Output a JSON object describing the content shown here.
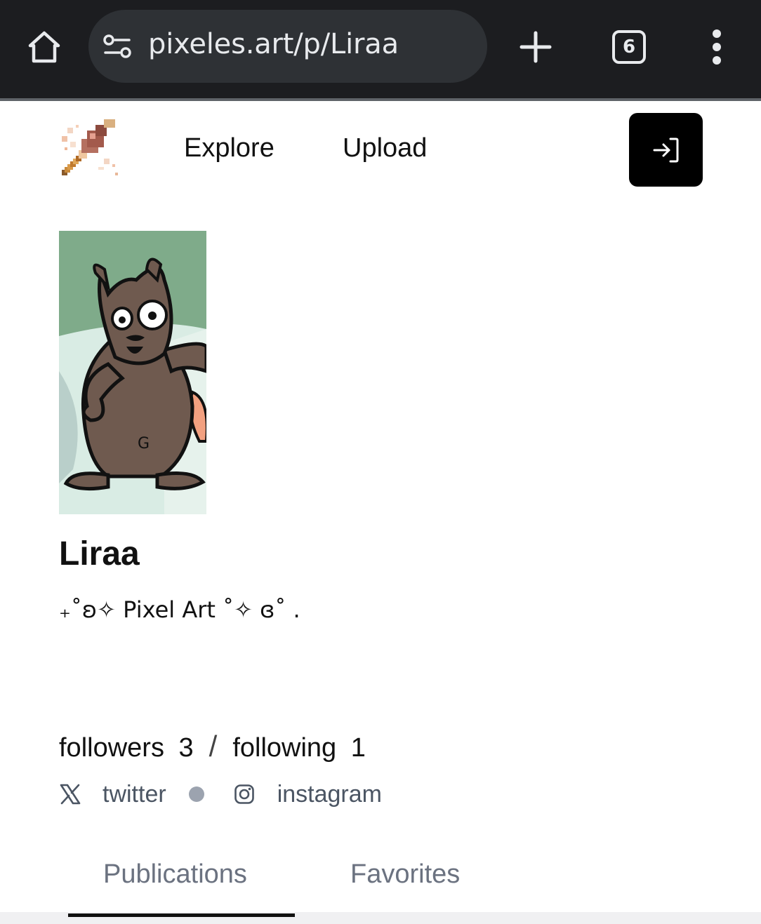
{
  "browser": {
    "url": "pixeles.art/p/Liraa",
    "tab_count": "6"
  },
  "nav": {
    "explore_label": "Explore",
    "upload_label": "Upload"
  },
  "profile": {
    "username": "Liraa",
    "bio": "₊˚ʚ✧ Pixel Art ˚✧ ɞ˚ .",
    "followers_label": "followers",
    "followers_count": "3",
    "separator": "/",
    "following_label": "following",
    "following_count": "1",
    "socials": [
      {
        "label": "twitter",
        "icon": "x-icon"
      },
      {
        "label": "instagram",
        "icon": "instagram-icon"
      }
    ]
  },
  "tabs": [
    {
      "label": "Publications",
      "active": true
    },
    {
      "label": "Favorites",
      "active": false
    }
  ],
  "colors": {
    "chrome_bg": "#1c1d20",
    "omnibox_bg": "#2e3135",
    "muted_text": "#6b7280",
    "login_bg": "#000000"
  }
}
